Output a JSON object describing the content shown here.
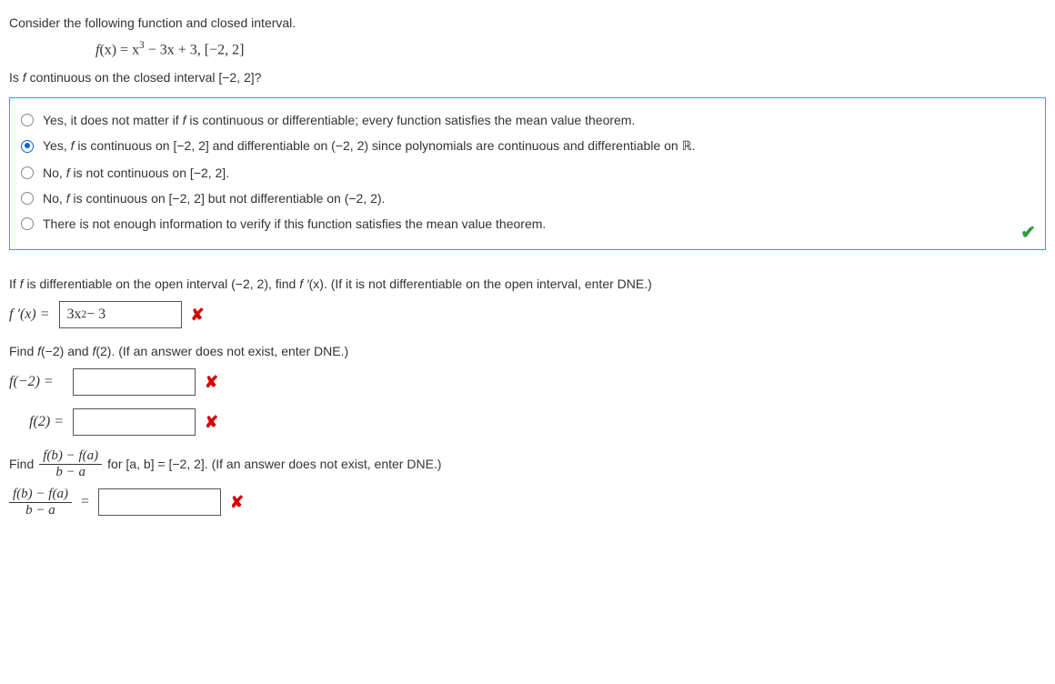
{
  "intro": "Consider the following function and closed interval.",
  "function_prefix": "f",
  "function_arg": "(x) = x",
  "function_exp": "3",
  "function_rest": " − 3x + 3,   [−2, 2]",
  "q1": "Is f continuous on the closed interval [−2, 2]?",
  "options": [
    {
      "text": "Yes, it does not matter if f is continuous or differentiable; every function satisfies the mean value theorem.",
      "selected": false
    },
    {
      "text": "Yes, f is continuous on [−2, 2] and differentiable on (−2, 2) since polynomials are continuous and differentiable on ℝ.",
      "selected": true,
      "has_R": true
    },
    {
      "text": "No, f is not continuous on [−2, 2].",
      "selected": false
    },
    {
      "text": "No, f is continuous on [−2, 2] but not differentiable on (−2, 2).",
      "selected": false
    },
    {
      "text": "There is not enough information to verify if this function satisfies the mean value theorem.",
      "selected": false
    }
  ],
  "q2": "If f is differentiable on the open interval (−2, 2), find f ′(x). (If it is not differentiable on the open interval, enter DNE.)",
  "fprime_label": "f ′(x) =",
  "fprime_value_pre": "3x",
  "fprime_value_exp": "2",
  "fprime_value_post": " − 3",
  "q3": "Find f(−2) and f(2). (If an answer does not exist, enter DNE.)",
  "fneg2_label": "f(−2) =",
  "fneg2_value": "",
  "f2_label": "f(2) =",
  "f2_value": "",
  "q4_pre": "Find ",
  "q4_num": "f(b) − f(a)",
  "q4_den": "b − a",
  "q4_post": " for [a, b] = [−2, 2]. (If an answer does not exist, enter DNE.)",
  "frac_label_num": "f(b) − f(a)",
  "frac_label_den": "b − a",
  "frac_eq": " =",
  "frac_value": "",
  "options_text": {
    "opt0_a": "Yes, it does not matter if ",
    "opt0_f": "f ",
    "opt0_b": "is continuous or differentiable; every function satisfies the mean value theorem.",
    "opt1_a": "Yes, ",
    "opt1_f": "f ",
    "opt1_b": "is continuous on [−2, 2] and differentiable on (−2, 2) since polynomials are continuous and differentiable on ",
    "opt1_r": "ℝ",
    "opt1_c": ".",
    "opt2_a": "No, ",
    "opt2_f": "f ",
    "opt2_b": "is not continuous on [−2, 2].",
    "opt3_a": "No, ",
    "opt3_f": "f ",
    "opt3_b": "is continuous on [−2, 2] but not differentiable on (−2, 2).",
    "opt4_a": "There is not enough information to verify if this function satisfies the mean value theorem."
  },
  "q2_parts": {
    "a": "If ",
    "f": "f ",
    "b": "is differentiable on the open interval (−2, 2), find ",
    "fp": "f ′",
    "c": "(x). (If it is not differentiable on the open interval, enter DNE.)"
  },
  "q1_parts": {
    "a": "Is ",
    "f": "f ",
    "b": "continuous on the closed interval [−2, 2]?"
  },
  "q3_parts": {
    "a": "Find ",
    "f1": "f",
    "b": "(−2) and ",
    "f2": "f",
    "c": "(2). (If an answer does not exist, enter DNE.)"
  }
}
